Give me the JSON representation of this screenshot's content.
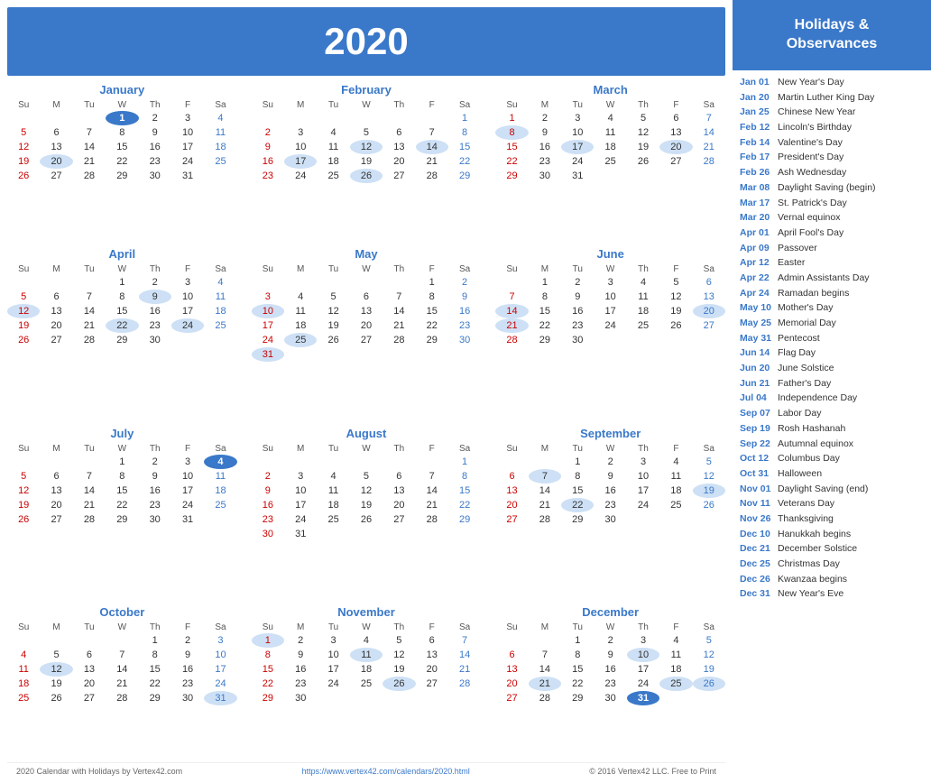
{
  "year": "2020",
  "sidebar": {
    "header": "Holidays &\nObservances",
    "holidays": [
      {
        "date": "Jan 01",
        "name": "New Year's Day"
      },
      {
        "date": "Jan 20",
        "name": "Martin Luther King Day"
      },
      {
        "date": "Jan 25",
        "name": "Chinese New Year"
      },
      {
        "date": "Feb 12",
        "name": "Lincoln's Birthday"
      },
      {
        "date": "Feb 14",
        "name": "Valentine's Day"
      },
      {
        "date": "Feb 17",
        "name": "President's Day"
      },
      {
        "date": "Feb 26",
        "name": "Ash Wednesday"
      },
      {
        "date": "Mar 08",
        "name": "Daylight Saving (begin)"
      },
      {
        "date": "Mar 17",
        "name": "St. Patrick's Day"
      },
      {
        "date": "Mar 20",
        "name": "Vernal equinox"
      },
      {
        "date": "Apr 01",
        "name": "April Fool's Day"
      },
      {
        "date": "Apr 09",
        "name": "Passover"
      },
      {
        "date": "Apr 12",
        "name": "Easter"
      },
      {
        "date": "Apr 22",
        "name": "Admin Assistants Day"
      },
      {
        "date": "Apr 24",
        "name": "Ramadan begins"
      },
      {
        "date": "May 10",
        "name": "Mother's Day"
      },
      {
        "date": "May 25",
        "name": "Memorial Day"
      },
      {
        "date": "May 31",
        "name": "Pentecost"
      },
      {
        "date": "Jun 14",
        "name": "Flag Day"
      },
      {
        "date": "Jun 20",
        "name": "June Solstice"
      },
      {
        "date": "Jun 21",
        "name": "Father's Day"
      },
      {
        "date": "Jul 04",
        "name": "Independence Day"
      },
      {
        "date": "Sep 07",
        "name": "Labor Day"
      },
      {
        "date": "Sep 19",
        "name": "Rosh Hashanah"
      },
      {
        "date": "Sep 22",
        "name": "Autumnal equinox"
      },
      {
        "date": "Oct 12",
        "name": "Columbus Day"
      },
      {
        "date": "Oct 31",
        "name": "Halloween"
      },
      {
        "date": "Nov 01",
        "name": "Daylight Saving (end)"
      },
      {
        "date": "Nov 11",
        "name": "Veterans Day"
      },
      {
        "date": "Nov 26",
        "name": "Thanksgiving"
      },
      {
        "date": "Dec 10",
        "name": "Hanukkah begins"
      },
      {
        "date": "Dec 21",
        "name": "December Solstice"
      },
      {
        "date": "Dec 25",
        "name": "Christmas Day"
      },
      {
        "date": "Dec 26",
        "name": "Kwanzaa begins"
      },
      {
        "date": "Dec 31",
        "name": "New Year's Eve"
      }
    ]
  },
  "months": [
    {
      "name": "January",
      "weeks": [
        [
          "",
          "",
          "",
          "1",
          "2",
          "3",
          "4"
        ],
        [
          "5",
          "6",
          "7",
          "8",
          "9",
          "10",
          "11"
        ],
        [
          "12",
          "13",
          "14",
          "15",
          "16",
          "17",
          "18"
        ],
        [
          "19",
          "20",
          "21",
          "22",
          "23",
          "24",
          "25"
        ],
        [
          "26",
          "27",
          "28",
          "29",
          "30",
          "31",
          ""
        ]
      ],
      "highlights": {
        "1": "holiday",
        "20": "blue",
        "25": ""
      }
    },
    {
      "name": "February",
      "weeks": [
        [
          "",
          "",
          "",
          "",
          "",
          "",
          "1"
        ],
        [
          "2",
          "3",
          "4",
          "5",
          "6",
          "7",
          "8"
        ],
        [
          "9",
          "10",
          "11",
          "12",
          "13",
          "14",
          "15"
        ],
        [
          "16",
          "17",
          "18",
          "19",
          "20",
          "21",
          "22"
        ],
        [
          "23",
          "24",
          "25",
          "26",
          "27",
          "28",
          "29"
        ]
      ],
      "highlights": {
        "12": "blue",
        "14": "blue",
        "17": "blue",
        "26": "blue"
      }
    },
    {
      "name": "March",
      "weeks": [
        [
          "1",
          "2",
          "3",
          "4",
          "5",
          "6",
          "7"
        ],
        [
          "8",
          "9",
          "10",
          "11",
          "12",
          "13",
          "14"
        ],
        [
          "15",
          "16",
          "17",
          "18",
          "19",
          "20",
          "21"
        ],
        [
          "22",
          "23",
          "24",
          "25",
          "26",
          "27",
          "28"
        ],
        [
          "29",
          "30",
          "31",
          "",
          "",
          "",
          ""
        ]
      ],
      "highlights": {
        "8": "blue",
        "17": "blue",
        "20": "blue"
      }
    },
    {
      "name": "April",
      "weeks": [
        [
          "",
          "",
          "",
          "1",
          "2",
          "3",
          "4"
        ],
        [
          "5",
          "6",
          "7",
          "8",
          "9",
          "10",
          "11"
        ],
        [
          "12",
          "13",
          "14",
          "15",
          "16",
          "17",
          "18"
        ],
        [
          "19",
          "20",
          "21",
          "22",
          "23",
          "24",
          "25"
        ],
        [
          "26",
          "27",
          "28",
          "29",
          "30",
          "",
          ""
        ]
      ],
      "highlights": {
        "9": "blue",
        "12": "blue",
        "22": "blue",
        "24": "blue"
      }
    },
    {
      "name": "May",
      "weeks": [
        [
          "",
          "",
          "",
          "",
          "",
          "1",
          "2"
        ],
        [
          "3",
          "4",
          "5",
          "6",
          "7",
          "8",
          "9"
        ],
        [
          "10",
          "11",
          "12",
          "13",
          "14",
          "15",
          "16"
        ],
        [
          "17",
          "18",
          "19",
          "20",
          "21",
          "22",
          "23"
        ],
        [
          "24",
          "25",
          "26",
          "27",
          "28",
          "29",
          "30"
        ],
        [
          "31",
          "",
          "",
          "",
          "",
          "",
          ""
        ]
      ],
      "highlights": {
        "10": "blue",
        "25": "blue",
        "31": "blue"
      }
    },
    {
      "name": "June",
      "weeks": [
        [
          "",
          "1",
          "2",
          "3",
          "4",
          "5",
          "6"
        ],
        [
          "7",
          "8",
          "9",
          "10",
          "11",
          "12",
          "13"
        ],
        [
          "14",
          "15",
          "16",
          "17",
          "18",
          "19",
          "20"
        ],
        [
          "21",
          "22",
          "23",
          "24",
          "25",
          "26",
          "27"
        ],
        [
          "28",
          "29",
          "30",
          "",
          "",
          "",
          ""
        ]
      ],
      "highlights": {
        "14": "blue",
        "20": "blue",
        "21": "blue"
      }
    },
    {
      "name": "July",
      "weeks": [
        [
          "",
          "",
          "",
          "1",
          "2",
          "3",
          "4"
        ],
        [
          "5",
          "6",
          "7",
          "8",
          "9",
          "10",
          "11"
        ],
        [
          "12",
          "13",
          "14",
          "15",
          "16",
          "17",
          "18"
        ],
        [
          "19",
          "20",
          "21",
          "22",
          "23",
          "24",
          "25"
        ],
        [
          "26",
          "27",
          "28",
          "29",
          "30",
          "31",
          ""
        ]
      ],
      "highlights": {
        "4": "holiday"
      }
    },
    {
      "name": "August",
      "weeks": [
        [
          "",
          "",
          "",
          "",
          "",
          "",
          "1"
        ],
        [
          "2",
          "3",
          "4",
          "5",
          "6",
          "7",
          "8"
        ],
        [
          "9",
          "10",
          "11",
          "12",
          "13",
          "14",
          "15"
        ],
        [
          "16",
          "17",
          "18",
          "19",
          "20",
          "21",
          "22"
        ],
        [
          "23",
          "24",
          "25",
          "26",
          "27",
          "28",
          "29"
        ],
        [
          "30",
          "31",
          "",
          "",
          "",
          "",
          ""
        ]
      ],
      "highlights": {}
    },
    {
      "name": "September",
      "weeks": [
        [
          "",
          "",
          "1",
          "2",
          "3",
          "4",
          "5"
        ],
        [
          "6",
          "7",
          "8",
          "9",
          "10",
          "11",
          "12"
        ],
        [
          "13",
          "14",
          "15",
          "16",
          "17",
          "18",
          "19"
        ],
        [
          "20",
          "21",
          "22",
          "23",
          "24",
          "25",
          "26"
        ],
        [
          "27",
          "28",
          "29",
          "30",
          "",
          "",
          ""
        ]
      ],
      "highlights": {
        "7": "blue",
        "19": "blue",
        "22": "blue"
      }
    },
    {
      "name": "October",
      "weeks": [
        [
          "",
          "",
          "",
          "",
          "1",
          "2",
          "3"
        ],
        [
          "4",
          "5",
          "6",
          "7",
          "8",
          "9",
          "10"
        ],
        [
          "11",
          "12",
          "13",
          "14",
          "15",
          "16",
          "17"
        ],
        [
          "18",
          "19",
          "20",
          "21",
          "22",
          "23",
          "24"
        ],
        [
          "25",
          "26",
          "27",
          "28",
          "29",
          "30",
          "31"
        ]
      ],
      "highlights": {
        "12": "blue",
        "31": "blue"
      }
    },
    {
      "name": "November",
      "weeks": [
        [
          "1",
          "2",
          "3",
          "4",
          "5",
          "6",
          "7"
        ],
        [
          "8",
          "9",
          "10",
          "11",
          "12",
          "13",
          "14"
        ],
        [
          "15",
          "16",
          "17",
          "18",
          "19",
          "20",
          "21"
        ],
        [
          "22",
          "23",
          "24",
          "25",
          "26",
          "27",
          "28"
        ],
        [
          "29",
          "30",
          "",
          "",
          "",
          "",
          ""
        ]
      ],
      "highlights": {
        "1": "blue",
        "11": "blue",
        "26": "blue"
      }
    },
    {
      "name": "December",
      "weeks": [
        [
          "",
          "",
          "1",
          "2",
          "3",
          "4",
          "5"
        ],
        [
          "6",
          "7",
          "8",
          "9",
          "10",
          "11",
          "12"
        ],
        [
          "13",
          "14",
          "15",
          "16",
          "17",
          "18",
          "19"
        ],
        [
          "20",
          "21",
          "22",
          "23",
          "24",
          "25",
          "26"
        ],
        [
          "27",
          "28",
          "29",
          "30",
          "31",
          "",
          ""
        ]
      ],
      "highlights": {
        "10": "blue",
        "21": "blue",
        "25": "blue",
        "26": "blue",
        "31": "holiday"
      }
    }
  ],
  "footer": {
    "left": "2020 Calendar with Holidays by Vertex42.com",
    "center": "https://www.vertex42.com/calendars/2020.html",
    "right": "© 2016 Vertex42 LLC. Free to Print"
  }
}
